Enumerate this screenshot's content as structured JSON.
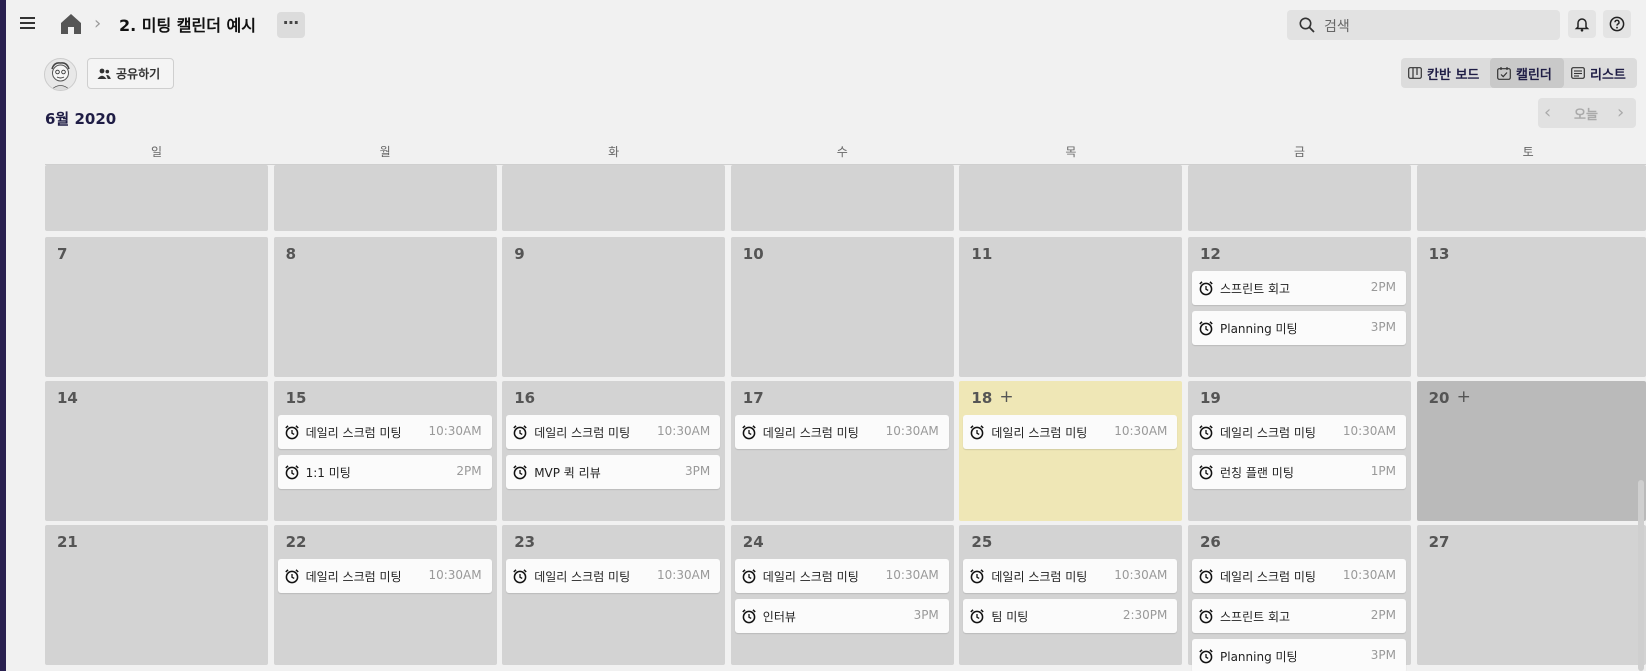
{
  "breadcrumb": {
    "separator": "›",
    "title": "2. 미팅 캘린더 예시",
    "more": "⋯"
  },
  "search": {
    "placeholder": "검색"
  },
  "share": {
    "label": "공유하기"
  },
  "views": [
    {
      "label": "칸반 보드",
      "icon": "kanban-icon",
      "active": false
    },
    {
      "label": "캘린더",
      "icon": "calendar-icon",
      "active": true
    },
    {
      "label": "리스트",
      "icon": "list-icon",
      "active": false
    }
  ],
  "month_label": "6월 2020",
  "nav": {
    "prev": "‹",
    "today": "오늘",
    "next": "›"
  },
  "weekdays": [
    "일",
    "월",
    "화",
    "수",
    "목",
    "금",
    "토"
  ],
  "weeks": [
    {
      "partial": true,
      "days": [
        {
          "date": "",
          "events": []
        },
        {
          "date": "",
          "events": []
        },
        {
          "date": "",
          "events": []
        },
        {
          "date": "",
          "events": []
        },
        {
          "date": "",
          "events": []
        },
        {
          "date": "",
          "events": []
        },
        {
          "date": "",
          "events": []
        }
      ]
    },
    {
      "days": [
        {
          "date": "7",
          "events": []
        },
        {
          "date": "8",
          "events": []
        },
        {
          "date": "9",
          "events": []
        },
        {
          "date": "10",
          "events": []
        },
        {
          "date": "11",
          "events": []
        },
        {
          "date": "12",
          "events": [
            {
              "title": "스프린트 회고",
              "time": "2PM"
            },
            {
              "title": "Planning 미팅",
              "time": "3PM"
            }
          ]
        },
        {
          "date": "13",
          "events": []
        }
      ]
    },
    {
      "days": [
        {
          "date": "14",
          "events": []
        },
        {
          "date": "15",
          "events": [
            {
              "title": "데일리 스크럼 미팅",
              "time": "10:30AM"
            },
            {
              "title": "1:1 미팅",
              "time": "2PM"
            }
          ]
        },
        {
          "date": "16",
          "events": [
            {
              "title": "데일리 스크럼 미팅",
              "time": "10:30AM"
            },
            {
              "title": "MVP 퀵 리뷰",
              "time": "3PM"
            }
          ]
        },
        {
          "date": "17",
          "events": [
            {
              "title": "데일리 스크럼 미팅",
              "time": "10:30AM"
            }
          ]
        },
        {
          "date": "18",
          "today": true,
          "plus": "+",
          "events": [
            {
              "title": "데일리 스크럼 미팅",
              "time": "10:30AM"
            }
          ]
        },
        {
          "date": "19",
          "events": [
            {
              "title": "데일리 스크럼 미팅",
              "time": "10:30AM"
            },
            {
              "title": "런칭 플랜 미팅",
              "time": "1PM"
            }
          ]
        },
        {
          "date": "20",
          "weekend": true,
          "plus": "+",
          "events": []
        }
      ]
    },
    {
      "days": [
        {
          "date": "21",
          "events": []
        },
        {
          "date": "22",
          "events": [
            {
              "title": "데일리 스크럼 미팅",
              "time": "10:30AM"
            }
          ]
        },
        {
          "date": "23",
          "events": [
            {
              "title": "데일리 스크럼 미팅",
              "time": "10:30AM"
            }
          ]
        },
        {
          "date": "24",
          "events": [
            {
              "title": "데일리 스크럼 미팅",
              "time": "10:30AM"
            },
            {
              "title": "인터뷰",
              "time": "3PM"
            }
          ]
        },
        {
          "date": "25",
          "events": [
            {
              "title": "데일리 스크럼 미팅",
              "time": "10:30AM"
            },
            {
              "title": "팀 미팅",
              "time": "2:30PM"
            }
          ]
        },
        {
          "date": "26",
          "events": [
            {
              "title": "데일리 스크럼 미팅",
              "time": "10:30AM"
            },
            {
              "title": "스프린트 회고",
              "time": "2PM"
            },
            {
              "title": "Planning 미팅",
              "time": "3PM"
            }
          ]
        },
        {
          "date": "27",
          "events": []
        }
      ]
    }
  ],
  "colors": {
    "accent": "#1f1d45",
    "cell": "#d3d3d3",
    "today": "#efe7b6",
    "weekend_selected": "#bababa",
    "sidebar": "#2a2150"
  }
}
